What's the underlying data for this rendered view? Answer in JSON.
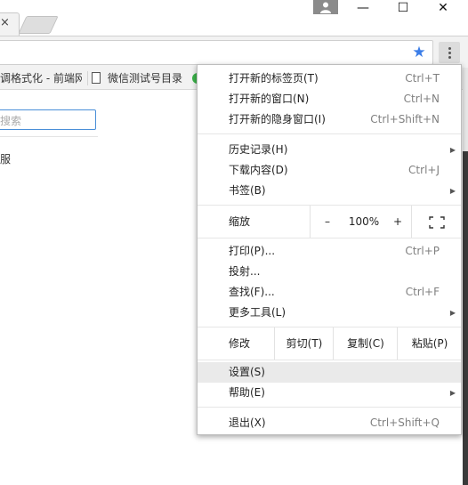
{
  "tab": {
    "close_glyph": "×"
  },
  "window": {
    "minimize": "—",
    "maximize": "☐",
    "close": "✕"
  },
  "toolbar": {
    "star_icon": "star-icon",
    "menu_icon": "three-dots-vertical-icon"
  },
  "bookmarks": {
    "items": [
      {
        "label": "调格式化 - 前端网"
      },
      {
        "label": "微信测试号目录"
      }
    ]
  },
  "page": {
    "search_placeholder": "搜索",
    "text": "服"
  },
  "menu": {
    "new_tab": {
      "label": "打开新的标签页(T)",
      "shortcut": "Ctrl+T"
    },
    "new_window": {
      "label": "打开新的窗口(N)",
      "shortcut": "Ctrl+N"
    },
    "incognito": {
      "label": "打开新的隐身窗口(I)",
      "shortcut": "Ctrl+Shift+N"
    },
    "history": {
      "label": "历史记录(H)"
    },
    "downloads": {
      "label": "下载内容(D)",
      "shortcut": "Ctrl+J"
    },
    "bookmarks": {
      "label": "书签(B)"
    },
    "zoom": {
      "label": "缩放",
      "minus": "–",
      "value": "100%",
      "plus": "+"
    },
    "print": {
      "label": "打印(P)...",
      "shortcut": "Ctrl+P"
    },
    "cast": {
      "label": "投射..."
    },
    "find": {
      "label": "查找(F)...",
      "shortcut": "Ctrl+F"
    },
    "more_tools": {
      "label": "更多工具(L)"
    },
    "edit": {
      "label": "修改",
      "cut": "剪切(T)",
      "copy": "复制(C)",
      "paste": "粘贴(P)"
    },
    "settings": {
      "label": "设置(S)"
    },
    "help": {
      "label": "帮助(E)"
    },
    "exit": {
      "label": "退出(X)",
      "shortcut": "Ctrl+Shift+Q"
    }
  },
  "colors": {
    "accent": "#3b7de8",
    "highlight": "#eaeaea"
  }
}
